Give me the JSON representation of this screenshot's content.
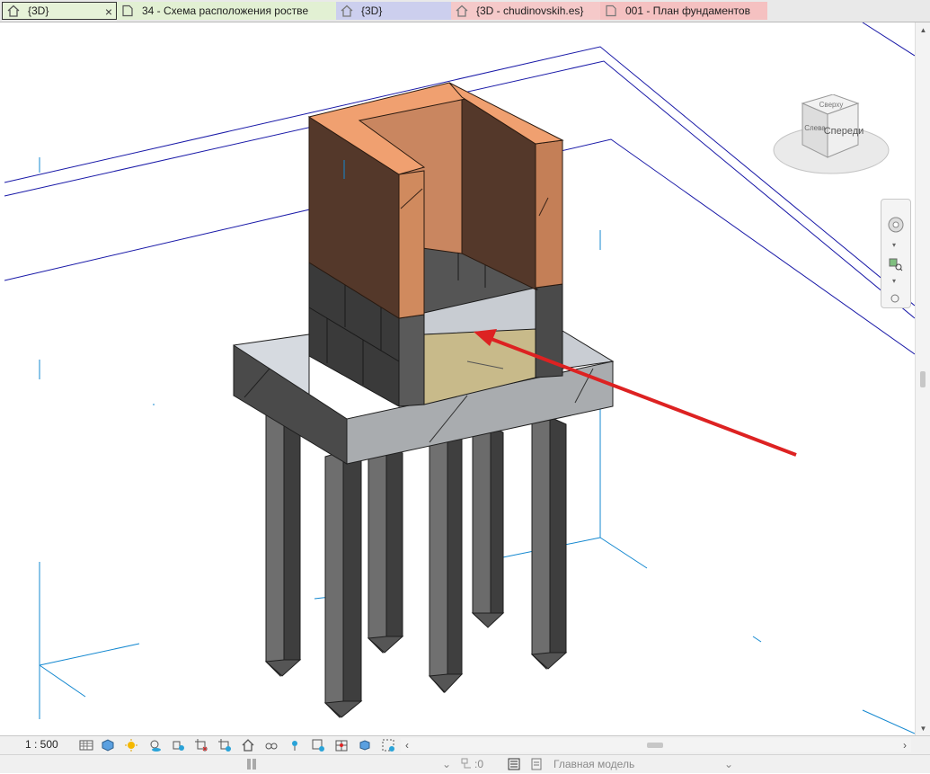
{
  "tabs": [
    {
      "label": "{3D}",
      "icon": "house-icon",
      "active": true,
      "close": "×"
    },
    {
      "label": "34 - Схема расположения роствe",
      "icon": "sheet-icon",
      "active": false
    },
    {
      "label": "{3D}",
      "icon": "house-icon",
      "active": false
    },
    {
      "label": "{3D - chudinovskih.es}",
      "icon": "house-icon",
      "active": false
    },
    {
      "label": "001 - План фундаментов",
      "icon": "sheet-icon",
      "active": false
    }
  ],
  "viewcube": {
    "front_label": "Спереди",
    "left_label": "Слева",
    "top_label": "Сверху"
  },
  "viewbar": {
    "scale": "1 : 500"
  },
  "statusbar": {
    "worksets": ":0",
    "active_model": "Главная модель"
  },
  "colors": {
    "brick_dark": "#54382a",
    "brick_light": "#f1a070",
    "brick_mid": "#c98660",
    "block_dark": "#3d3d3d",
    "concrete_light": "#d2d6dc",
    "concrete_side": "#4a4a4a",
    "sand": "#c8ba8a",
    "pile": "#6e6e6e",
    "annotation_arrow": "#dd2222",
    "grid_blue": "#00008b",
    "grid_cyan": "#0a78c8"
  }
}
